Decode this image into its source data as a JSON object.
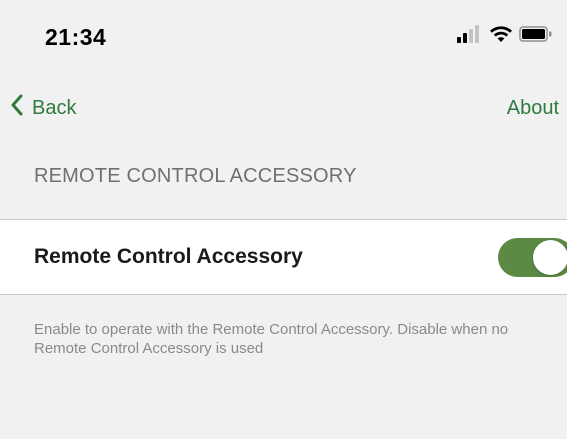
{
  "status_bar": {
    "time": "21:34",
    "icons": [
      "signal-icon",
      "wifi-icon",
      "battery-icon"
    ]
  },
  "nav": {
    "back_label": "Back",
    "about_label": "About"
  },
  "section": {
    "header": "REMOTE CONTROL ACCESSORY"
  },
  "setting": {
    "label": "Remote Control Accessory",
    "enabled": true
  },
  "footer": {
    "description": "Enable to operate with the Remote Control Accessory. Disable when no Remote Control Accessory is used"
  },
  "colors": {
    "accent": "#2f7a3e",
    "toggle_on": "#5c8a45",
    "background": "#f1f1f1",
    "row_background": "#ffffff",
    "secondary_text": "#707070"
  }
}
